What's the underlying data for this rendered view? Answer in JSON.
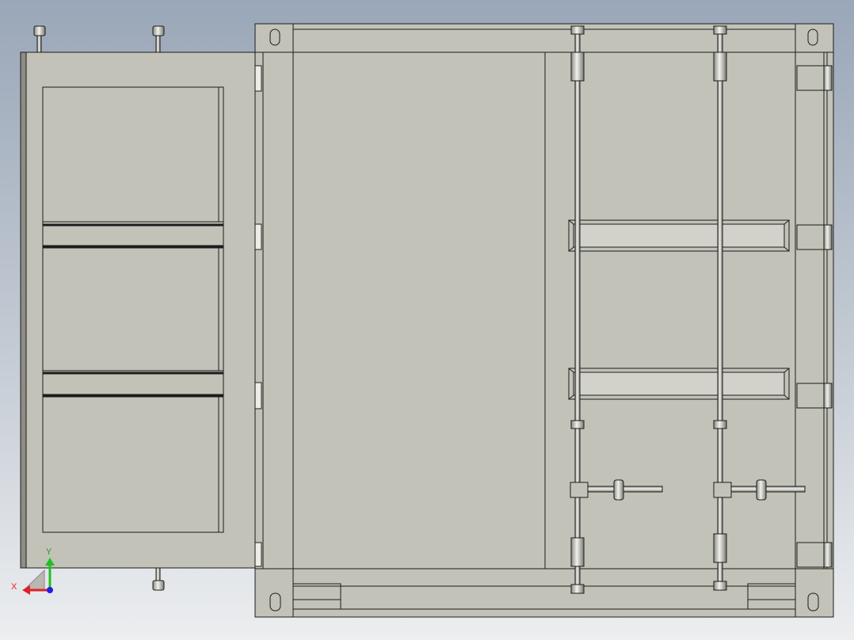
{
  "viewport": {
    "background_top": "#9aa7b8",
    "background_bottom": "#eceef0",
    "part_fill": "#c2c2b8",
    "edge_color": "#1c1c1c",
    "highlight_fill": "#e4e4dc"
  },
  "triad": {
    "x_label": "X",
    "y_label": "Y",
    "x_color": "#e0202a",
    "y_color": "#20c020",
    "z_color": "#2020e0"
  }
}
